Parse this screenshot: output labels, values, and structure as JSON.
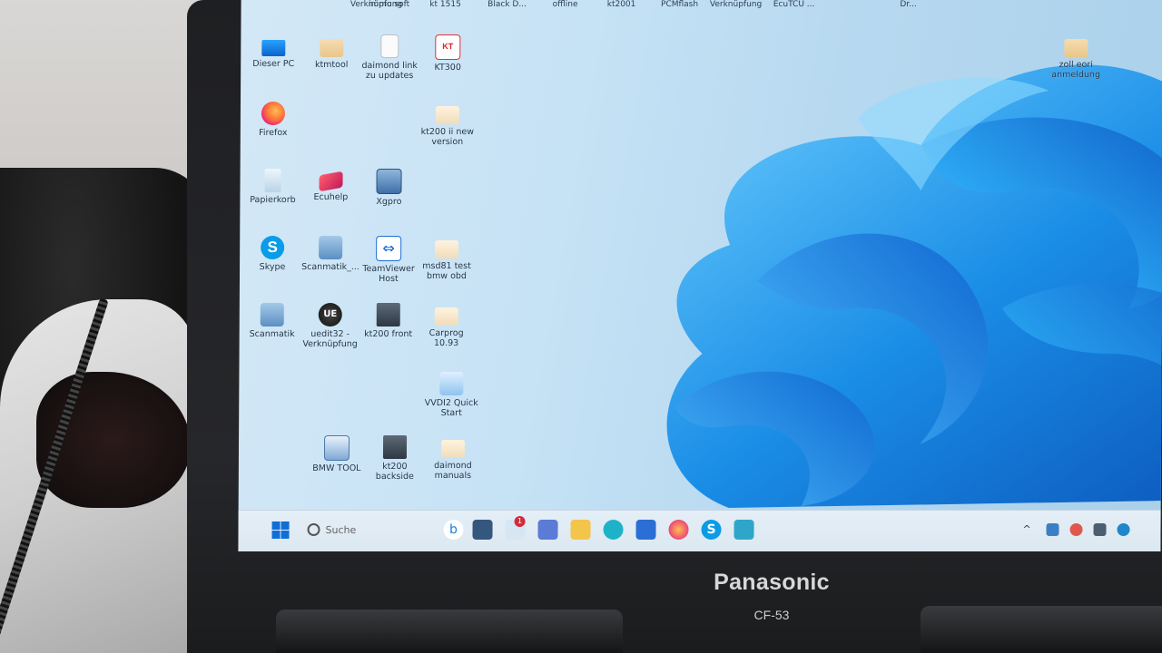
{
  "top_row_labels": [
    "Verknüpfung",
    "immo soft",
    "kt 1515",
    "Black D...",
    "offline",
    "kt2001",
    "PCMflash",
    "Verknüpfung",
    "EcuTCU ...",
    "",
    "Dr..."
  ],
  "desktop_icons": [
    {
      "label": "Dieser PC",
      "icon": "computer-icon"
    },
    {
      "label": "ktmtool",
      "icon": "folder-icon"
    },
    {
      "label": "daimond link zu updates",
      "icon": "document-icon"
    },
    {
      "label": "KT300",
      "icon": "kt300-icon",
      "glyph_text": "KT"
    },
    {
      "label": "zoll eori anmeldung",
      "icon": "folder-icon"
    },
    {
      "label": "Firefox",
      "icon": "firefox-icon"
    },
    {
      "label": "kt200 ii new version",
      "icon": "folder-icon"
    },
    {
      "label": "Papierkorb",
      "icon": "recycle-bin-icon"
    },
    {
      "label": "Ecuhelp",
      "icon": "ecuhelp-icon"
    },
    {
      "label": "Xgpro",
      "icon": "xgpro-icon"
    },
    {
      "label": "Skype",
      "icon": "skype-icon",
      "glyph_text": "S"
    },
    {
      "label": "Scanmatik_...",
      "icon": "scanmatik-icon"
    },
    {
      "label": "TeamViewer Host",
      "icon": "teamviewer-icon"
    },
    {
      "label": "msd81 test bmw obd",
      "icon": "folder-icon"
    },
    {
      "label": "Scanmatik",
      "icon": "scanmatik-icon"
    },
    {
      "label": "uedit32 - Verknüpfung",
      "icon": "ultraedit-icon",
      "glyph_text": "UE"
    },
    {
      "label": "kt200 front",
      "icon": "board-icon"
    },
    {
      "label": "Carprog 10.93",
      "icon": "folder-icon"
    },
    {
      "label": "VVDI2 Quick Start",
      "icon": "vvdi-icon"
    },
    {
      "label": "BMW TOOL",
      "icon": "bmw-tool-icon"
    },
    {
      "label": "kt200 backside",
      "icon": "board-icon"
    },
    {
      "label": "daimond manuals",
      "icon": "folder-icon"
    }
  ],
  "taskbar": {
    "search_placeholder": "Suche",
    "notification_count": "1",
    "skype_glyph": "S",
    "apps": [
      "bing-chat-icon",
      "widgets-icon",
      "chat-icon",
      "meet-icon",
      "file-explorer-icon",
      "edge-icon",
      "store-icon",
      "firefox-icon",
      "skype-icon",
      "app-icon"
    ],
    "tray": [
      "chevron-up-icon",
      "network-icon",
      "sync-icon",
      "display-icon",
      "security-icon"
    ]
  },
  "laptop": {
    "brand": "Panasonic",
    "model": "CF-53"
  },
  "colors": {
    "accent": "#0f6fd6",
    "wallpaper": "#1f8fe6",
    "taskbar": "#e1ecf4"
  }
}
